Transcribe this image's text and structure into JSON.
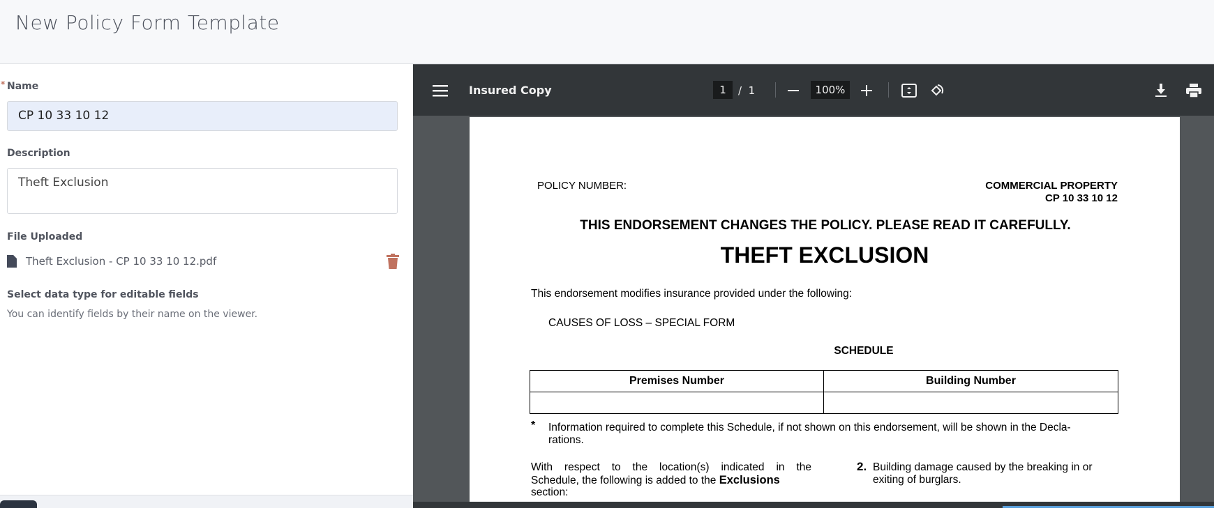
{
  "header": {
    "title": "New Policy Form Template"
  },
  "form": {
    "name_label": "Name",
    "required_mark": "*",
    "name_value": "CP 10 33 10 12",
    "description_label": "Description",
    "description_value": "Theft Exclusion",
    "file_label": "File Uploaded",
    "file_name": "Theft Exclusion - CP 10 33 10 12.pdf",
    "data_type_label": "Select data type for editable fields",
    "data_type_help": "You can identify fields by their name on the viewer."
  },
  "viewer": {
    "doc_title": "Insured Copy",
    "current_page": "1",
    "page_sep": "/",
    "total_pages": "1",
    "zoom": "100%",
    "icons": [
      "menu-icon",
      "zoom-out-icon",
      "zoom-in-icon",
      "fit-page-icon",
      "rotate-icon",
      "download-icon",
      "print-icon"
    ]
  },
  "document": {
    "policy_number_label": "POLICY NUMBER:",
    "line": "COMMERCIAL PROPERTY",
    "form_number": "CP 10 33 10 12",
    "notice": "THIS ENDORSEMENT CHANGES THE POLICY.  PLEASE READ IT CAREFULLY.",
    "title": "THEFT EXCLUSION",
    "intro": "This endorsement modifies insurance provided under the following:",
    "coverage_form": "CAUSES OF LOSS – SPECIAL FORM",
    "schedule_heading": "SCHEDULE",
    "schedule_columns": [
      "Premises Number",
      "Building Number"
    ],
    "footnote_mark": "*",
    "footnote_line1": "Information required to complete this Schedule, if not shown on this endorsement, will be shown in the Decla-",
    "footnote_line2": "rations.",
    "left_col_line1": "With respect to the location(s) indicated in the",
    "left_col_line2_a": "Schedule, the following is added to the ",
    "left_col_line2_b": "Exclusions",
    "left_col_line3": "section:",
    "right_item_number": "2.",
    "right_item_line1": "Building damage caused by the breaking in or",
    "right_item_line2": "exiting of burglars."
  },
  "colors": {
    "accent_input": "#e8eefa",
    "trash": "#c0725f",
    "toolbar": "#323639"
  }
}
